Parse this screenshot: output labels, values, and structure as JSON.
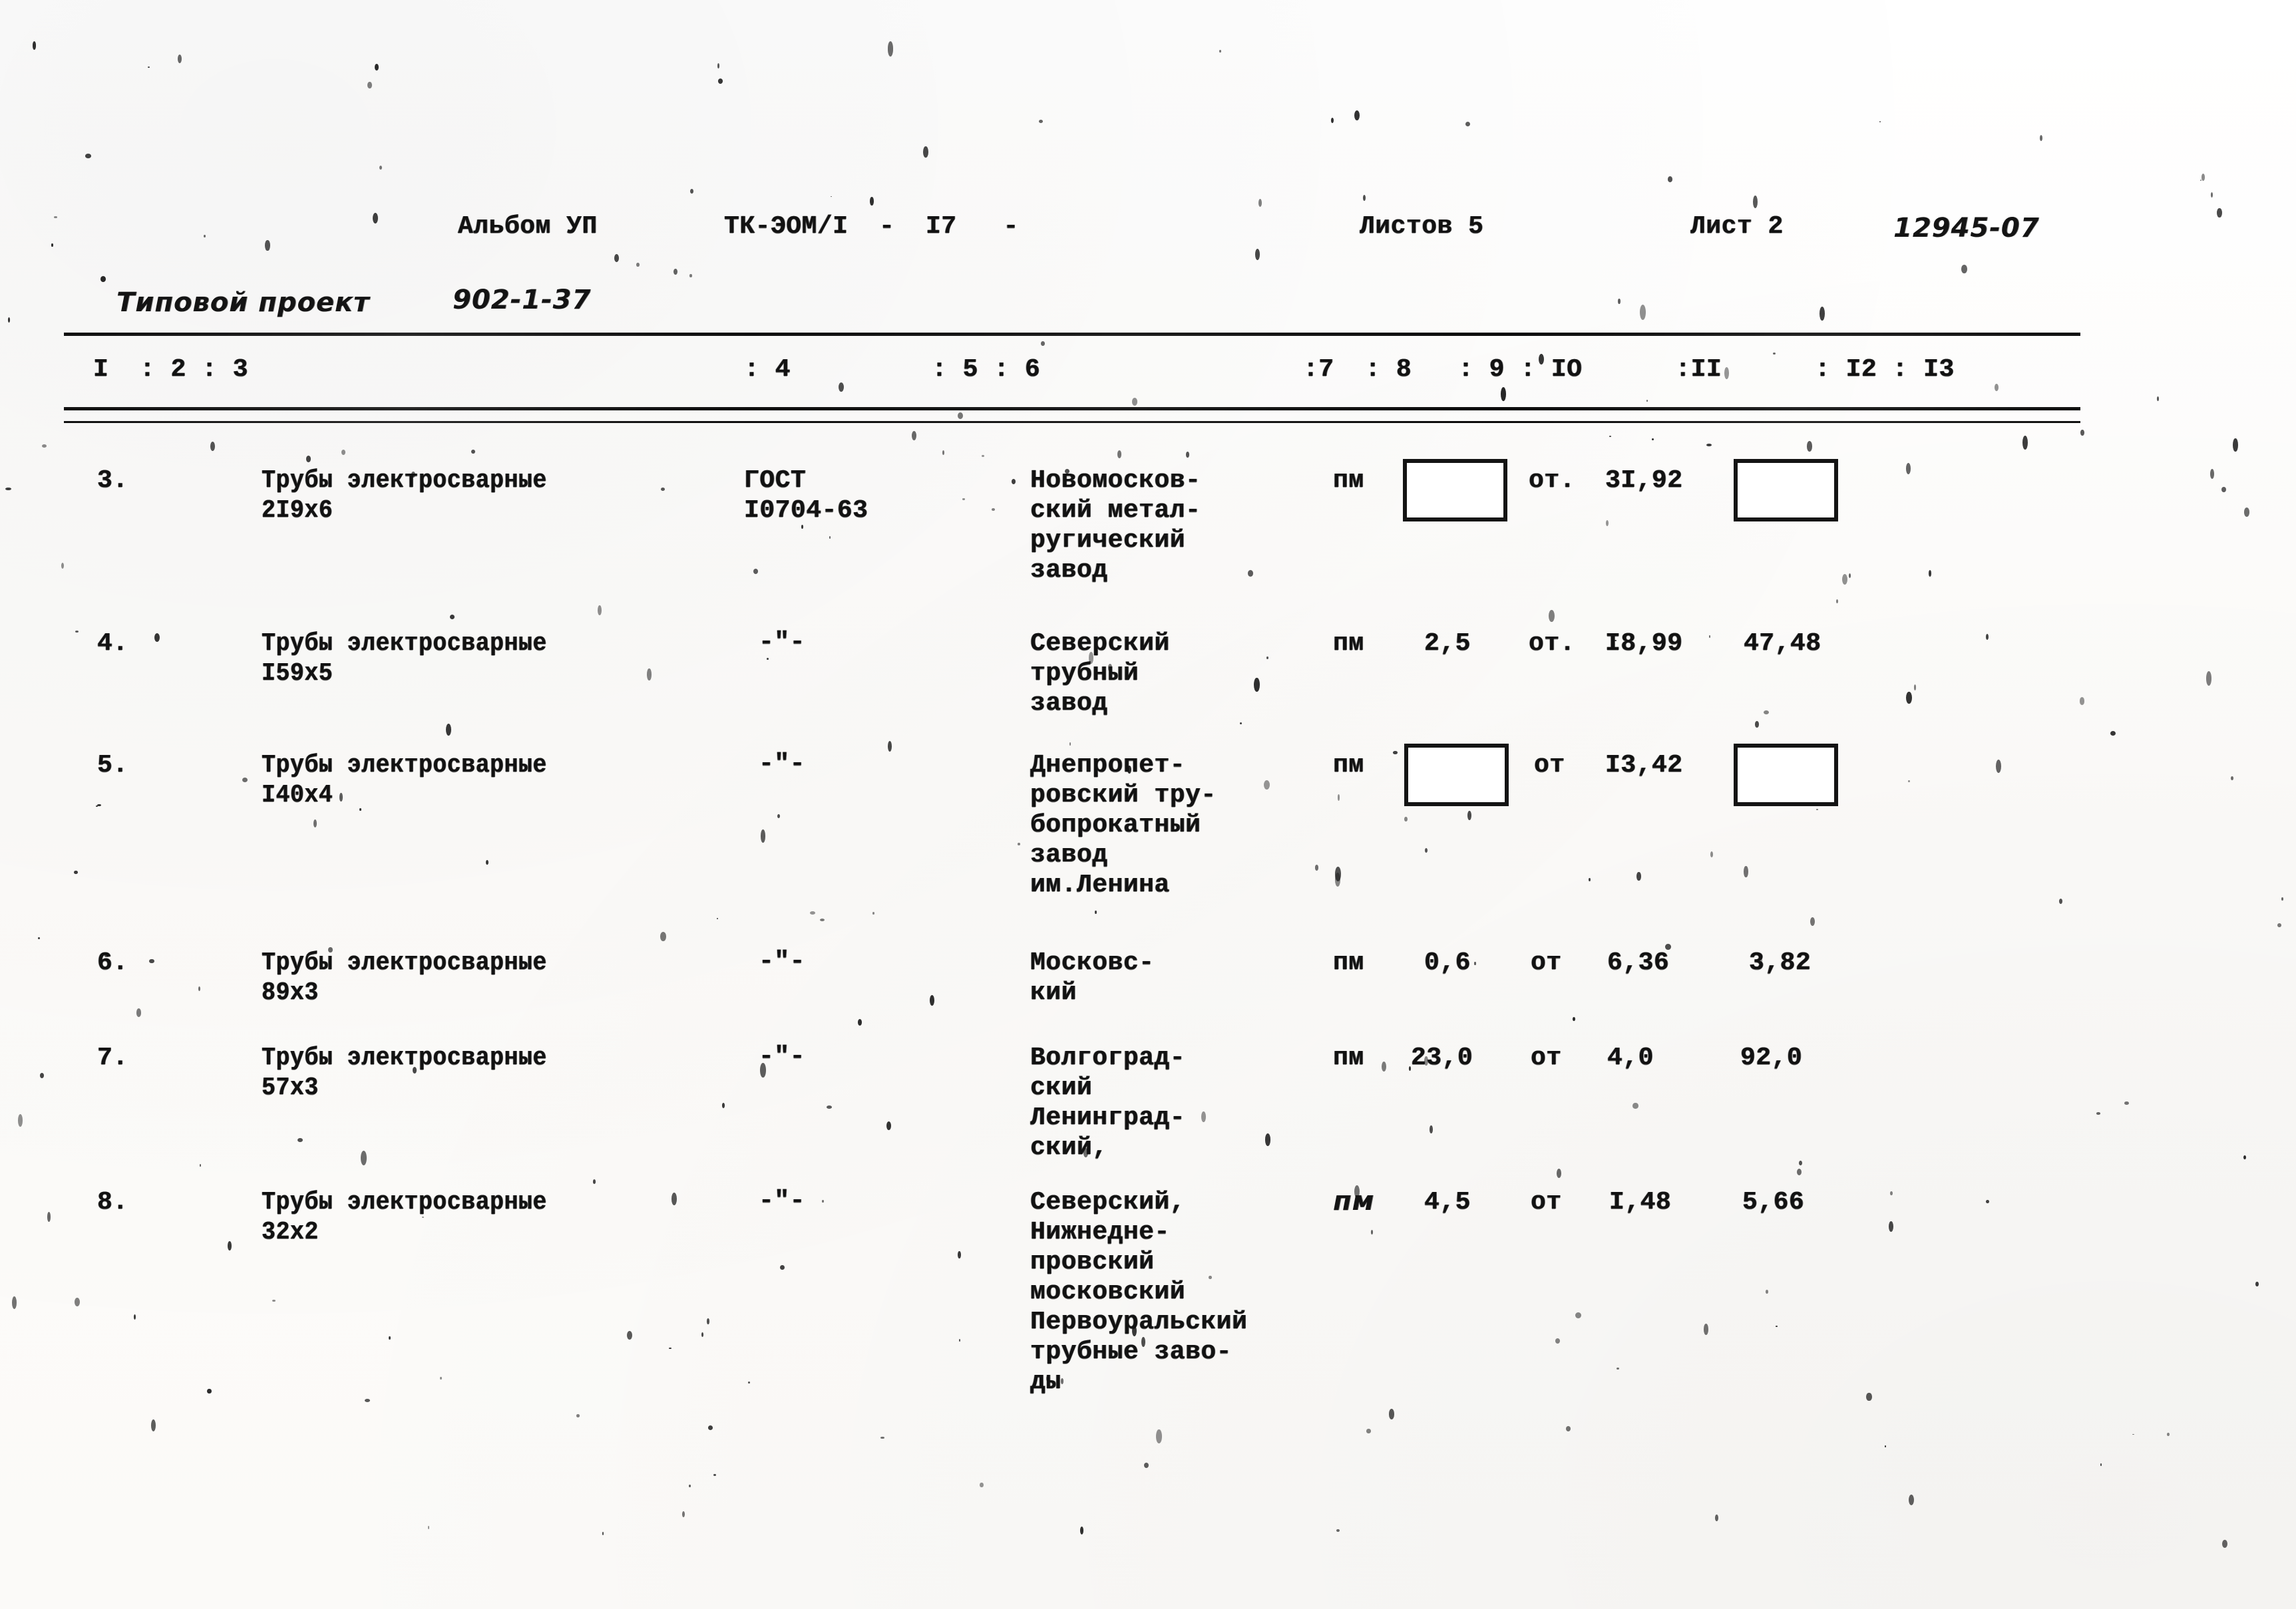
{
  "document": {
    "type": "scanned-technical-specification-sheet",
    "language": "ru"
  },
  "header": {
    "album_label": "Альбом УП",
    "code": "ТК-ЭОМ/I  -  I7   -",
    "sheets_total_label": "Листов 5",
    "sheet_label": "Лист 2",
    "drawing_number": "12945-07",
    "project_label": "Типовой проект",
    "project_number": "902-1-37"
  },
  "column_header": {
    "left": "I  : 2 : 3",
    "mid1": ": 4",
    "mid2": ": 5 : 6",
    "right": ":7  : 8   : 9 : IO      :II      : I2 : I3"
  },
  "columns": [
    "I",
    "2",
    "3",
    "4",
    "5",
    "6",
    "7",
    "8",
    "9",
    "IO",
    "II",
    "I2",
    "I3"
  ],
  "rows": [
    {
      "no": "3.",
      "name_line1": "Трубы электросварные",
      "name_line2": "2I9х6",
      "standard_line1": "ГОСТ",
      "standard_line2": "I0704-63",
      "supplier_lines": [
        "Новомосков-",
        "ский метал-",
        "ругический",
        "завод"
      ],
      "unit": "пм",
      "qty": "",
      "qty_boxed": true,
      "price_prefix": "от.",
      "price": "3I,92",
      "total": "",
      "total_boxed": true
    },
    {
      "no": "4.",
      "name_line1": "Трубы электросварные",
      "name_line2": "I59х5",
      "standard_line1": "-\"-",
      "standard_line2": "",
      "supplier_lines": [
        "Северский",
        "трубный",
        "завод"
      ],
      "unit": "пм",
      "qty": "2,5",
      "qty_boxed": false,
      "price_prefix": "от.",
      "price": "I8,99",
      "total": "47,48",
      "total_boxed": false
    },
    {
      "no": "5.",
      "name_line1": "Трубы электросварные",
      "name_line2": "I40х4",
      "standard_line1": "-\"-",
      "standard_line2": "",
      "supplier_lines": [
        "Днепропет-",
        "ровский тру-",
        "бопрокатный",
        "завод",
        "им.Ленина"
      ],
      "unit": "пм",
      "qty": "",
      "qty_boxed": true,
      "price_prefix": "от",
      "price": "I3,42",
      "total": "",
      "total_boxed": true
    },
    {
      "no": "6.",
      "name_line1": "Трубы электросварные",
      "name_line2": "89х3",
      "standard_line1": "-\"-",
      "standard_line2": "",
      "supplier_lines": [
        "Московс-",
        "кий"
      ],
      "unit": "пм",
      "qty": "0,6",
      "qty_boxed": false,
      "price_prefix": "от",
      "price": "6,36",
      "total": "3,82",
      "total_boxed": false
    },
    {
      "no": "7.",
      "name_line1": "Трубы электросварные",
      "name_line2": "57х3",
      "standard_line1": "-\"-",
      "standard_line2": "",
      "supplier_lines": [
        "Волгоград-",
        "ский",
        "Ленинград-",
        "ский,"
      ],
      "unit": "пм",
      "qty": "23,0",
      "qty_boxed": false,
      "price_prefix": "от",
      "price": "4,0",
      "total": "92,0",
      "total_boxed": false
    },
    {
      "no": "8.",
      "name_line1": "Трубы электросварные",
      "name_line2": "32х2",
      "standard_line1": "-\"-",
      "standard_line2": "",
      "supplier_lines": [
        "Северский,",
        "Нижнедне-",
        "провский",
        "московский",
        "Первоуральский",
        "трубные заво-",
        "ды"
      ],
      "unit": "пм",
      "unit_hand": true,
      "qty": "4,5",
      "qty_boxed": false,
      "price_prefix": "от",
      "price": "I,48",
      "total": "5,66",
      "total_boxed": false
    }
  ]
}
